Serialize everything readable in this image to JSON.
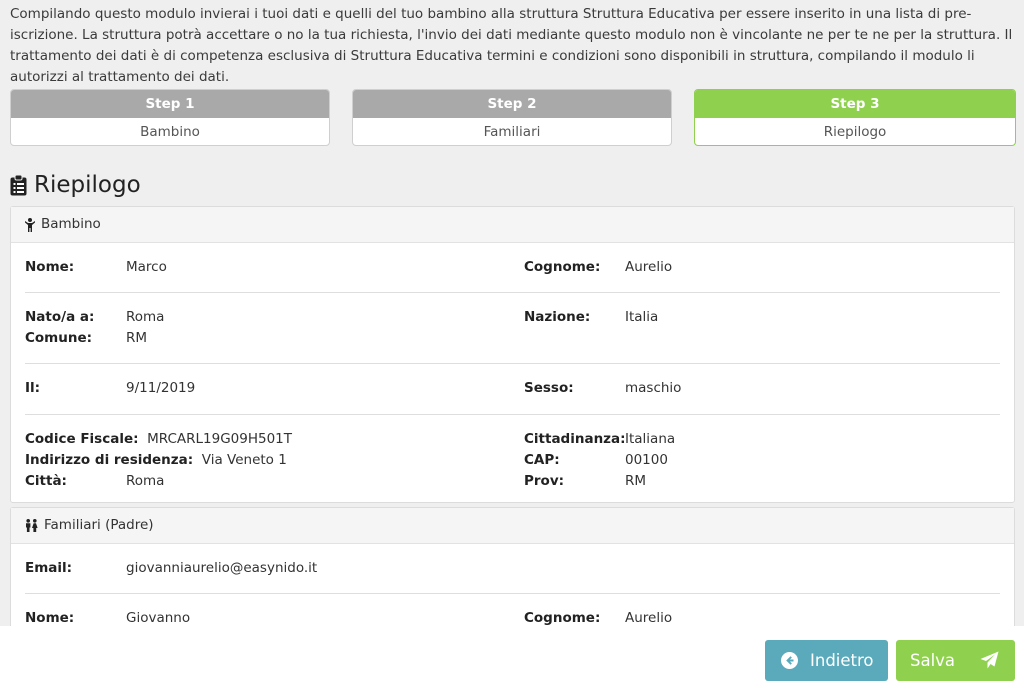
{
  "intro": {
    "text": "Compilando questo modulo invierai i tuoi dati e quelli del tuo bambino alla struttura Struttura Educativa per essere inserito in una lista di pre-iscrizione. La struttura potrà accettare o no la tua richiesta, l'invio dei dati mediante questo modulo non è vincolante ne per te ne per la struttura. Il trattamento dei dati è di competenza esclusiva di Struttura Educativa termini e condizioni sono disponibili in struttura, compilando il modulo li autorizzi al trattamento dei dati."
  },
  "steps": [
    {
      "title": "Step 1",
      "label": "Bambino",
      "active": false
    },
    {
      "title": "Step 2",
      "label": "Familiari",
      "active": false
    },
    {
      "title": "Step 3",
      "label": "Riepilogo",
      "active": true
    }
  ],
  "section": {
    "title": "Riepilogo",
    "icon": "clipboard-icon"
  },
  "bambino": {
    "header": "Bambino",
    "icon": "child-icon",
    "nome_label": "Nome:",
    "nome": "Marco",
    "cognome_label": "Cognome:",
    "cognome": "Aurelio",
    "nato_label": "Nato/a a:",
    "nato": "Roma",
    "comune_label": "Comune:",
    "comune": "RM",
    "nazione_label": "Nazione:",
    "nazione": "Italia",
    "il_label": "Il:",
    "il": "9/11/2019",
    "sesso_label": "Sesso:",
    "sesso": "maschio",
    "cf_label": "Codice Fiscale:",
    "cf": "MRCARL19G09H501T",
    "indirizzo_label": "Indirizzo di residenza:",
    "indirizzo": "Via Veneto 1",
    "citta_label": "Città:",
    "citta": "Roma",
    "cittadinanza_label": "Cittadinanza:",
    "cittadinanza": "Italiana",
    "cap_label": "CAP:",
    "cap": "00100",
    "prov_label": "Prov:",
    "prov": "RM"
  },
  "padre": {
    "header": "Familiari (Padre)",
    "icon": "family-icon",
    "email_label": "Email:",
    "email": "giovanniaurelio@easynido.it",
    "nome_label": "Nome:",
    "nome": "Giovanno",
    "cognome_label": "Cognome:",
    "cognome": "Aurelio"
  },
  "footer": {
    "back_label": "Indietro",
    "back_icon": "arrow-circle-left-icon",
    "save_label": "Salva",
    "save_icon": "paper-plane-icon"
  },
  "colors": {
    "accent_green": "#8fd14f",
    "back_button": "#5aaabb",
    "step_inactive": "#a9a9a9"
  }
}
